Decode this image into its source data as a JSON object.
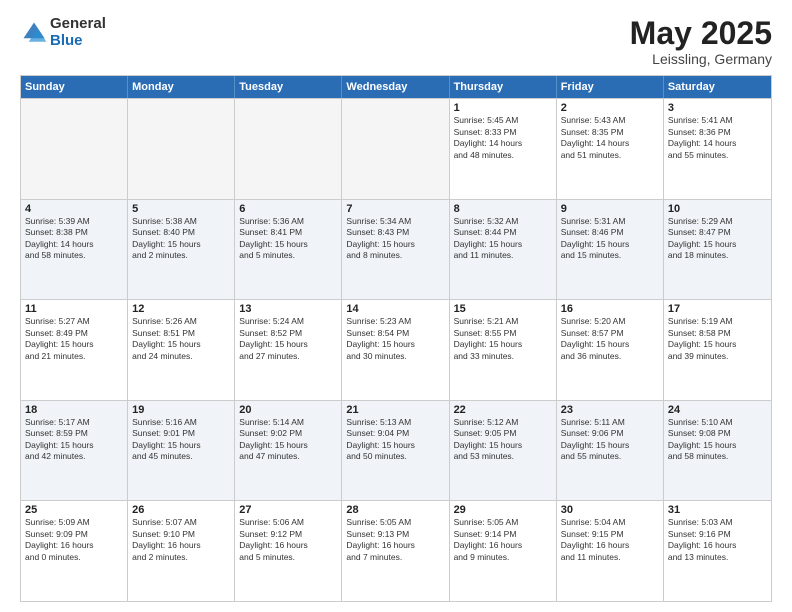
{
  "logo": {
    "general": "General",
    "blue": "Blue"
  },
  "title": "May 2025",
  "subtitle": "Leissling, Germany",
  "header_days": [
    "Sunday",
    "Monday",
    "Tuesday",
    "Wednesday",
    "Thursday",
    "Friday",
    "Saturday"
  ],
  "rows": [
    {
      "alt": false,
      "cells": [
        {
          "num": "",
          "text": "",
          "empty": true
        },
        {
          "num": "",
          "text": "",
          "empty": true
        },
        {
          "num": "",
          "text": "",
          "empty": true
        },
        {
          "num": "",
          "text": "",
          "empty": true
        },
        {
          "num": "1",
          "text": "Sunrise: 5:45 AM\nSunset: 8:33 PM\nDaylight: 14 hours\nand 48 minutes.",
          "empty": false
        },
        {
          "num": "2",
          "text": "Sunrise: 5:43 AM\nSunset: 8:35 PM\nDaylight: 14 hours\nand 51 minutes.",
          "empty": false
        },
        {
          "num": "3",
          "text": "Sunrise: 5:41 AM\nSunset: 8:36 PM\nDaylight: 14 hours\nand 55 minutes.",
          "empty": false
        }
      ]
    },
    {
      "alt": true,
      "cells": [
        {
          "num": "4",
          "text": "Sunrise: 5:39 AM\nSunset: 8:38 PM\nDaylight: 14 hours\nand 58 minutes.",
          "empty": false
        },
        {
          "num": "5",
          "text": "Sunrise: 5:38 AM\nSunset: 8:40 PM\nDaylight: 15 hours\nand 2 minutes.",
          "empty": false
        },
        {
          "num": "6",
          "text": "Sunrise: 5:36 AM\nSunset: 8:41 PM\nDaylight: 15 hours\nand 5 minutes.",
          "empty": false
        },
        {
          "num": "7",
          "text": "Sunrise: 5:34 AM\nSunset: 8:43 PM\nDaylight: 15 hours\nand 8 minutes.",
          "empty": false
        },
        {
          "num": "8",
          "text": "Sunrise: 5:32 AM\nSunset: 8:44 PM\nDaylight: 15 hours\nand 11 minutes.",
          "empty": false
        },
        {
          "num": "9",
          "text": "Sunrise: 5:31 AM\nSunset: 8:46 PM\nDaylight: 15 hours\nand 15 minutes.",
          "empty": false
        },
        {
          "num": "10",
          "text": "Sunrise: 5:29 AM\nSunset: 8:47 PM\nDaylight: 15 hours\nand 18 minutes.",
          "empty": false
        }
      ]
    },
    {
      "alt": false,
      "cells": [
        {
          "num": "11",
          "text": "Sunrise: 5:27 AM\nSunset: 8:49 PM\nDaylight: 15 hours\nand 21 minutes.",
          "empty": false
        },
        {
          "num": "12",
          "text": "Sunrise: 5:26 AM\nSunset: 8:51 PM\nDaylight: 15 hours\nand 24 minutes.",
          "empty": false
        },
        {
          "num": "13",
          "text": "Sunrise: 5:24 AM\nSunset: 8:52 PM\nDaylight: 15 hours\nand 27 minutes.",
          "empty": false
        },
        {
          "num": "14",
          "text": "Sunrise: 5:23 AM\nSunset: 8:54 PM\nDaylight: 15 hours\nand 30 minutes.",
          "empty": false
        },
        {
          "num": "15",
          "text": "Sunrise: 5:21 AM\nSunset: 8:55 PM\nDaylight: 15 hours\nand 33 minutes.",
          "empty": false
        },
        {
          "num": "16",
          "text": "Sunrise: 5:20 AM\nSunset: 8:57 PM\nDaylight: 15 hours\nand 36 minutes.",
          "empty": false
        },
        {
          "num": "17",
          "text": "Sunrise: 5:19 AM\nSunset: 8:58 PM\nDaylight: 15 hours\nand 39 minutes.",
          "empty": false
        }
      ]
    },
    {
      "alt": true,
      "cells": [
        {
          "num": "18",
          "text": "Sunrise: 5:17 AM\nSunset: 8:59 PM\nDaylight: 15 hours\nand 42 minutes.",
          "empty": false
        },
        {
          "num": "19",
          "text": "Sunrise: 5:16 AM\nSunset: 9:01 PM\nDaylight: 15 hours\nand 45 minutes.",
          "empty": false
        },
        {
          "num": "20",
          "text": "Sunrise: 5:14 AM\nSunset: 9:02 PM\nDaylight: 15 hours\nand 47 minutes.",
          "empty": false
        },
        {
          "num": "21",
          "text": "Sunrise: 5:13 AM\nSunset: 9:04 PM\nDaylight: 15 hours\nand 50 minutes.",
          "empty": false
        },
        {
          "num": "22",
          "text": "Sunrise: 5:12 AM\nSunset: 9:05 PM\nDaylight: 15 hours\nand 53 minutes.",
          "empty": false
        },
        {
          "num": "23",
          "text": "Sunrise: 5:11 AM\nSunset: 9:06 PM\nDaylight: 15 hours\nand 55 minutes.",
          "empty": false
        },
        {
          "num": "24",
          "text": "Sunrise: 5:10 AM\nSunset: 9:08 PM\nDaylight: 15 hours\nand 58 minutes.",
          "empty": false
        }
      ]
    },
    {
      "alt": false,
      "cells": [
        {
          "num": "25",
          "text": "Sunrise: 5:09 AM\nSunset: 9:09 PM\nDaylight: 16 hours\nand 0 minutes.",
          "empty": false
        },
        {
          "num": "26",
          "text": "Sunrise: 5:07 AM\nSunset: 9:10 PM\nDaylight: 16 hours\nand 2 minutes.",
          "empty": false
        },
        {
          "num": "27",
          "text": "Sunrise: 5:06 AM\nSunset: 9:12 PM\nDaylight: 16 hours\nand 5 minutes.",
          "empty": false
        },
        {
          "num": "28",
          "text": "Sunrise: 5:05 AM\nSunset: 9:13 PM\nDaylight: 16 hours\nand 7 minutes.",
          "empty": false
        },
        {
          "num": "29",
          "text": "Sunrise: 5:05 AM\nSunset: 9:14 PM\nDaylight: 16 hours\nand 9 minutes.",
          "empty": false
        },
        {
          "num": "30",
          "text": "Sunrise: 5:04 AM\nSunset: 9:15 PM\nDaylight: 16 hours\nand 11 minutes.",
          "empty": false
        },
        {
          "num": "31",
          "text": "Sunrise: 5:03 AM\nSunset: 9:16 PM\nDaylight: 16 hours\nand 13 minutes.",
          "empty": false
        }
      ]
    }
  ]
}
